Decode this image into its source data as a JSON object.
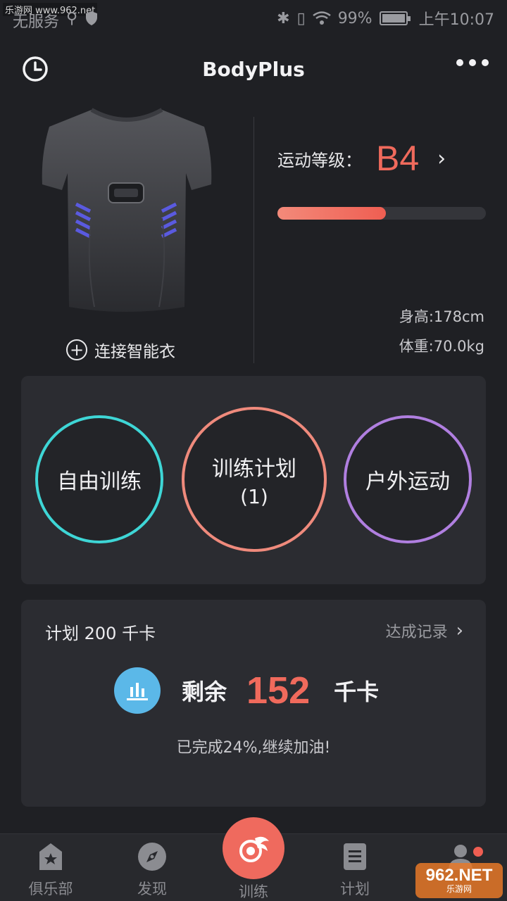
{
  "watermark_top": "乐游网 www.962.net",
  "status_bar": {
    "carrier": "无服务",
    "battery": "99%",
    "time": "上午10:07"
  },
  "header": {
    "title": "BodyPlus"
  },
  "device": {
    "connect_label": "连接智能衣"
  },
  "profile": {
    "level_label": "运动等级：",
    "level_value": "B4",
    "level_progress_percent": 52,
    "height": "身高:178cm",
    "weight": "体重:70.0kg"
  },
  "modes": {
    "free": "自由训练",
    "plan": "训练计划",
    "plan_count": "(1)",
    "outdoor": "户外运动"
  },
  "plan": {
    "title": "计划 200 千卡",
    "record": "达成记录",
    "remain_label": "剩余",
    "remain_value": "152",
    "remain_unit": "千卡",
    "note": "已完成24%,继续加油!"
  },
  "tabbar": {
    "club": "俱乐部",
    "discover": "发现",
    "train": "训练",
    "plan": "计划"
  },
  "watermark_logo": {
    "big": "962.NET",
    "small": "乐游网"
  },
  "colors": {
    "accent": "#ef6a5e",
    "free_ring": "#3ed6d6",
    "plan_ring": "#ef8a7c",
    "outdoor_ring": "#b07fe0",
    "badge": "#5bb8e8"
  }
}
